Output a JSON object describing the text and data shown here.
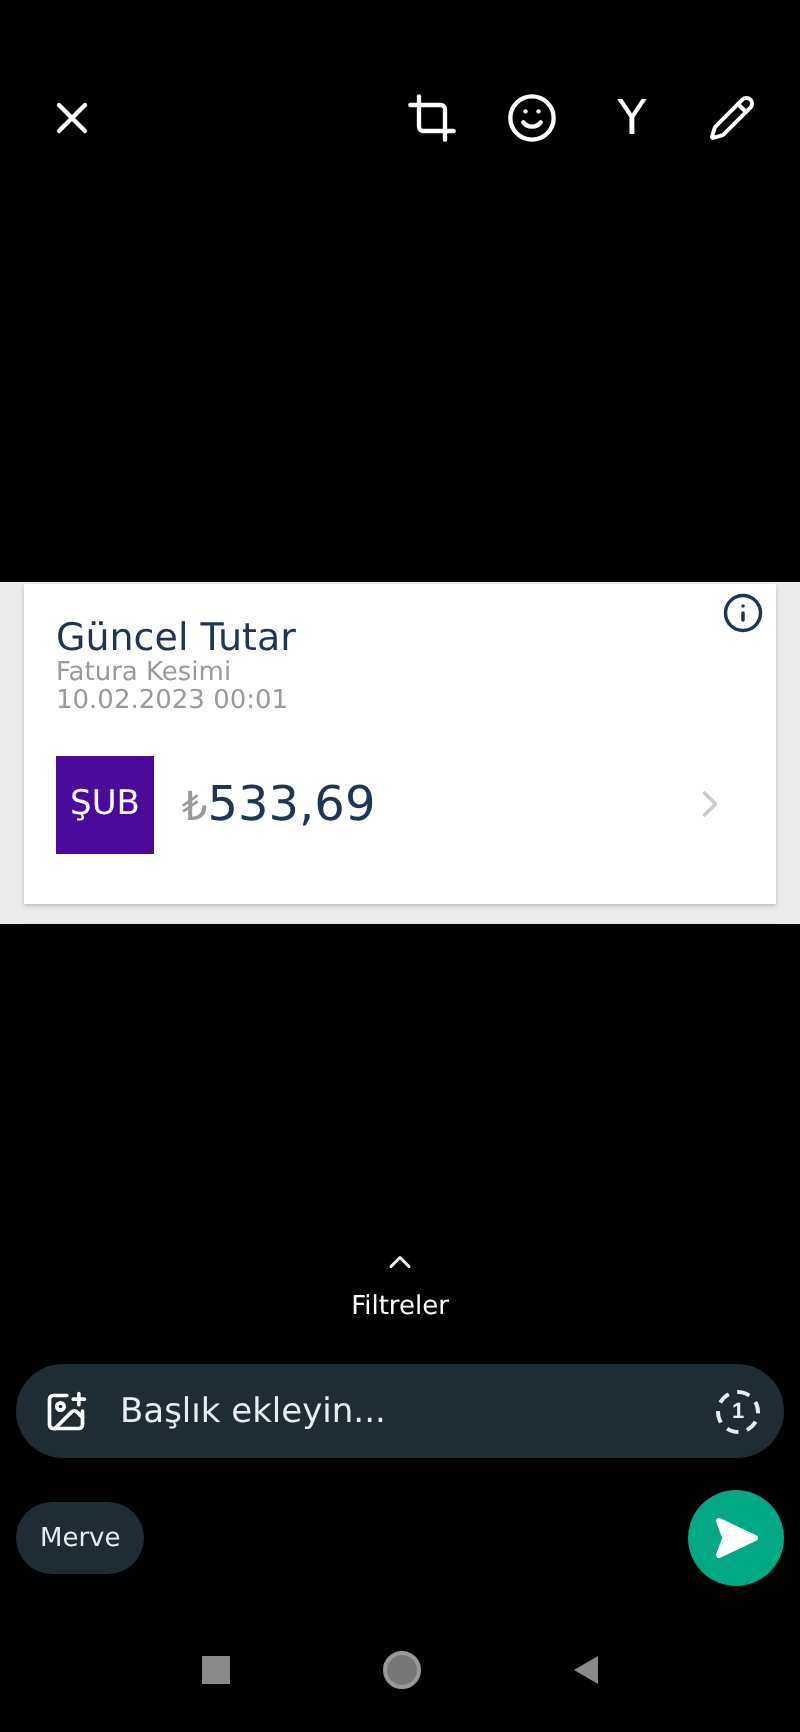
{
  "toolbar": {
    "text_tool": "Y"
  },
  "bill": {
    "title": "Güncel Tutar",
    "subtitle": "Fatura Kesimi",
    "date": "10.02.2023 00:01",
    "month": "ŞUB",
    "currency": "₺",
    "amount": "533,69"
  },
  "filters": {
    "label": "Filtreler"
  },
  "caption": {
    "placeholder": "Başlık ekleyin...",
    "view_once": "1"
  },
  "recipient": "Merve"
}
